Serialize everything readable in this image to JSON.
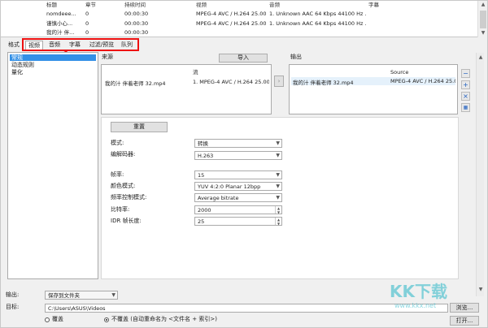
{
  "file_list": {
    "columns": [
      "标题",
      "章节",
      "持续时间",
      "视频",
      "音频",
      "字幕"
    ],
    "rows": [
      [
        "nomdeee...",
        "0",
        "00:00:30",
        "MPEG-4 AVC / H.264 25.00 fps...",
        "1. Unknown AAC  64 Kbps 44100 Hz ...",
        ""
      ],
      [
        "谨慎小心...",
        "0",
        "00:00:30",
        "MPEG-4 AVC / H.264 25.00 fps...",
        "1. Unknown AAC  64 Kbps 44100 Hz ...",
        ""
      ],
      [
        "我的汁 伴...",
        "0",
        "00:00:30",
        "",
        "",
        ""
      ]
    ]
  },
  "tabs": [
    "格式",
    "视频",
    "音频",
    "字幕",
    "过滤/预览",
    "队列"
  ],
  "selected_tab": "视频",
  "categories": [
    "常规",
    "动态规则",
    "量化"
  ],
  "source": {
    "header": "来源",
    "import_label": "导入",
    "stream_header": "流",
    "file_name": "我的汁 伴着老师 32.mp4",
    "stream_value": "1. MPEG-4 AVC / H.264 25.00 f"
  },
  "output": {
    "header": "输出",
    "source_header": "Source",
    "file_name": "我的汁 伴着老师 32.mp4",
    "source_value": "MPEG-4 AVC / H.264 25.00"
  },
  "reset_label": "重置",
  "settings": {
    "mode_label": "模式:",
    "mode_value": "转换",
    "encoder_label": "编解码器:",
    "encoder_value": "H.263",
    "framerate_label": "帧率:",
    "framerate_value": "15",
    "color_label": "颜色模式:",
    "color_value": "YUV 4:2:0 Planar 12bpp",
    "ratecontrol_label": "频率控制模式:",
    "ratecontrol_value": "Average bitrate",
    "bitrate_label": "比特率:",
    "bitrate_value": "2000",
    "idr_label": "IDR 帧长度:",
    "idr_value": "25"
  },
  "bottom": {
    "output_label": "输出:",
    "output_value": "保存到文件夹",
    "target_label": "目标:",
    "target_value": "C:\\Users\\ASUS\\Videos",
    "overwrite_label": "覆盖",
    "no_overwrite_label": "不覆盖 (自动重命名为 <文件名 + 索引>)",
    "browse_label": "浏览...",
    "open_label": "打开..."
  },
  "watermark": {
    "line1": "KK下载",
    "line2": "www.kkx.net"
  },
  "colors": {
    "accent": "#3390e6",
    "highlight": "#e11111",
    "watermark": "#29b6c8"
  }
}
